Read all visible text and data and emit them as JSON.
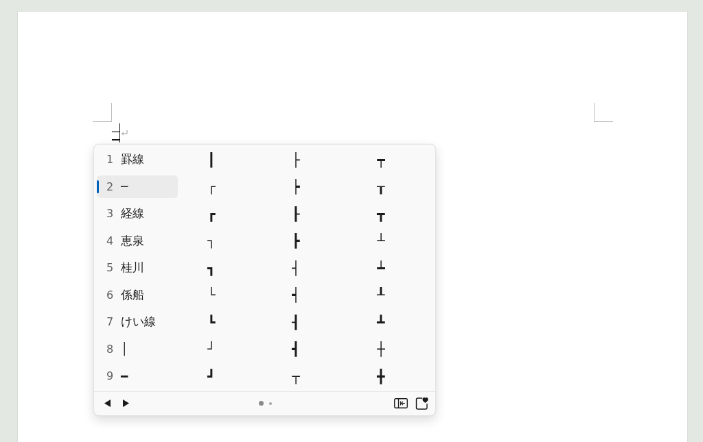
{
  "document": {
    "composition_text": "─"
  },
  "candidate_window": {
    "rows": [
      {
        "number": "1",
        "candidate": "罫線",
        "selected": false,
        "more": [
          "┃",
          "├",
          "┯"
        ]
      },
      {
        "number": "2",
        "candidate": "─",
        "selected": true,
        "more": [
          "┌",
          "┝",
          "┰"
        ]
      },
      {
        "number": "3",
        "candidate": "経線",
        "selected": false,
        "more": [
          "┏",
          "┠",
          "┳"
        ]
      },
      {
        "number": "4",
        "candidate": "恵泉",
        "selected": false,
        "more": [
          "┐",
          "┣",
          "┴"
        ]
      },
      {
        "number": "5",
        "candidate": "桂川",
        "selected": false,
        "more": [
          "┓",
          "┤",
          "┷"
        ]
      },
      {
        "number": "6",
        "candidate": "係船",
        "selected": false,
        "more": [
          "└",
          "┥",
          "┸"
        ]
      },
      {
        "number": "7",
        "candidate": "けい線",
        "selected": false,
        "more": [
          "┗",
          "┨",
          "┻"
        ]
      },
      {
        "number": "8",
        "candidate": "│",
        "selected": false,
        "more": [
          "┘",
          "┫",
          "┼"
        ]
      },
      {
        "number": "9",
        "candidate": "━",
        "selected": false,
        "more": [
          "┛",
          "┬",
          "╋"
        ]
      }
    ],
    "page_dots": [
      {
        "selected": true
      },
      {
        "selected": false
      }
    ]
  }
}
